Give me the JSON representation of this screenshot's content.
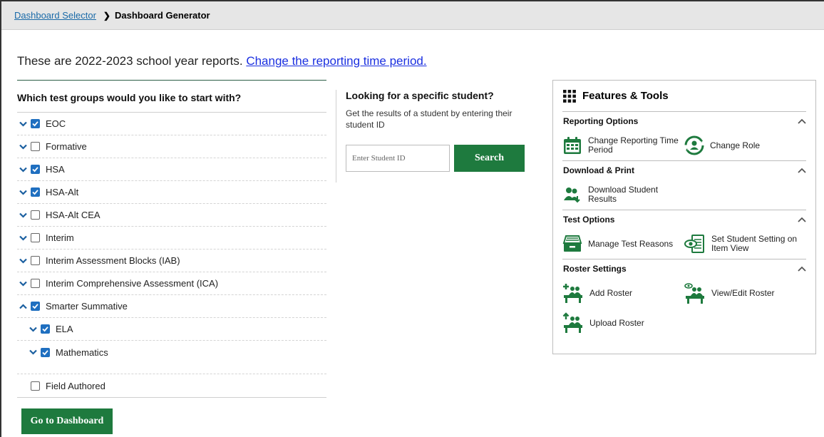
{
  "breadcrumb": {
    "parent": "Dashboard Selector",
    "current": "Dashboard Generator"
  },
  "period": {
    "text": "These are 2022-2023 school year reports.",
    "link": "Change the reporting time period."
  },
  "test_groups": {
    "heading": "Which test groups would you like to start with?",
    "items": [
      {
        "label": "EOC",
        "checked": true
      },
      {
        "label": "Formative",
        "checked": false
      },
      {
        "label": "HSA",
        "checked": true
      },
      {
        "label": "HSA-Alt",
        "checked": true
      },
      {
        "label": "HSA-Alt CEA",
        "checked": false
      },
      {
        "label": "Interim",
        "checked": false
      },
      {
        "label": "Interim Assessment Blocks (IAB)",
        "checked": false
      },
      {
        "label": "Interim Comprehensive Assessment (ICA)",
        "checked": false
      },
      {
        "label": "Smarter Summative",
        "checked": true,
        "expanded": true
      },
      {
        "label": "ELA",
        "checked": true
      },
      {
        "label": "Mathematics",
        "checked": true
      },
      {
        "label": "Field Authored",
        "checked": false
      }
    ]
  },
  "go_button": "Go to Dashboard",
  "student_search": {
    "heading": "Looking for a specific student?",
    "description": "Get the results of a student by entering their student ID",
    "placeholder": "Enter Student ID",
    "button": "Search"
  },
  "features": {
    "title": "Features & Tools",
    "accent_color": "#1e7a3e",
    "sections": [
      {
        "heading": "Reporting Options",
        "tools": [
          "Change Reporting Time Period",
          "Change Role"
        ]
      },
      {
        "heading": "Download & Print",
        "tools": [
          "Download Student Results"
        ]
      },
      {
        "heading": "Test Options",
        "tools": [
          "Manage Test Reasons",
          "Set Student Setting on Item View"
        ]
      },
      {
        "heading": "Roster Settings",
        "tools": [
          "Add Roster",
          "View/Edit Roster",
          "Upload Roster"
        ]
      }
    ]
  }
}
